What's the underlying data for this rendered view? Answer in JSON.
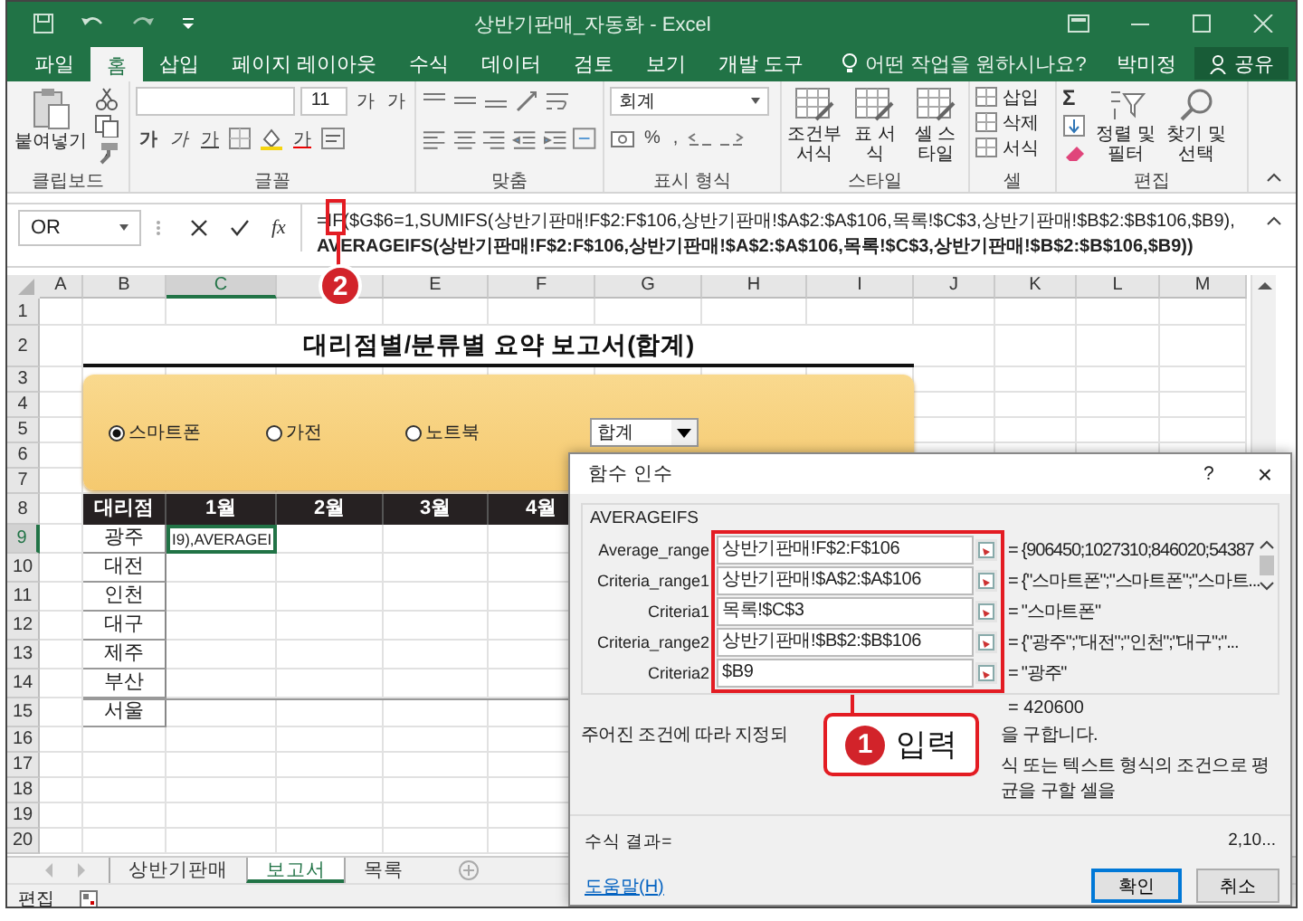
{
  "window": {
    "title": "상반기판매_자동화 - Excel"
  },
  "ribbon_tabs": [
    {
      "label": "파일",
      "selected": false
    },
    {
      "label": "홈",
      "selected": true
    },
    {
      "label": "삽입",
      "selected": false
    },
    {
      "label": "페이지 레이아웃",
      "selected": false
    },
    {
      "label": "수식",
      "selected": false
    },
    {
      "label": "데이터",
      "selected": false
    },
    {
      "label": "검토",
      "selected": false
    },
    {
      "label": "보기",
      "selected": false
    },
    {
      "label": "개발 도구",
      "selected": false
    }
  ],
  "tell_me": {
    "placeholder": "어떤 작업을 원하시나요?"
  },
  "user": "박미정",
  "share_button": "공유",
  "ribbon_groups": [
    {
      "kind": "clipboard",
      "label": "클립보드",
      "buttons": [
        "붙여넣기"
      ]
    },
    {
      "kind": "font",
      "label": "글꼴",
      "size": "11",
      "buttons": [
        "가",
        "가",
        "가",
        "가",
        "가",
        "가"
      ]
    },
    {
      "kind": "alignment",
      "label": "맞춤"
    },
    {
      "kind": "number",
      "label": "표시 형식",
      "format": "회계",
      "buttons": [
        "%",
        ","
      ]
    },
    {
      "kind": "styles",
      "label": "스타일",
      "buttons": [
        "조건부 서식",
        "표 서식",
        "셀 스타일"
      ]
    },
    {
      "kind": "cells",
      "label": "셀",
      "buttons": [
        "삽입",
        "삭제",
        "서식"
      ]
    },
    {
      "kind": "editing",
      "label": "편집",
      "buttons": [
        "Σ",
        "정렬 및 필터",
        "찾기 및 선택"
      ]
    }
  ],
  "formula_bar": {
    "name_box": "OR",
    "fx": "fx",
    "lines": [
      {
        "text": "=IF($G$6=1,SUMIFS(상반기판매!F$2:F$106,상반기판매!$A$2:$A$106,목록!$C$3,상반기판매!$B$2:$B$106,$B9),",
        "bold": false
      },
      {
        "text": "AVERAGEIFS(상반기판매!F$2:F$106,상반기판매!$A$2:$A$106,목록!$C$3,상반기판매!$B$2:$B$106,$B9))",
        "bold": true
      }
    ]
  },
  "columns": [
    {
      "label": "A",
      "selected": false
    },
    {
      "label": "B",
      "selected": false
    },
    {
      "label": "C",
      "selected": true
    },
    {
      "selected": false
    },
    {
      "label": "E",
      "selected": false
    },
    {
      "label": "F",
      "selected": false
    },
    {
      "label": "G",
      "selected": false
    },
    {
      "label": "H",
      "selected": false
    },
    {
      "label": "I",
      "selected": false
    },
    {
      "label": "J",
      "selected": false
    },
    {
      "label": "K",
      "selected": false
    },
    {
      "label": "L",
      "selected": false
    },
    {
      "label": "M",
      "selected": false
    }
  ],
  "rows": [
    {
      "label": "1",
      "selected": false
    },
    {
      "label": "2",
      "selected": false
    },
    {
      "label": "3",
      "selected": false
    },
    {
      "label": "4",
      "selected": false
    },
    {
      "label": "5",
      "selected": false
    },
    {
      "label": "6",
      "selected": false
    },
    {
      "label": "7",
      "selected": false
    },
    {
      "label": "8",
      "selected": false
    },
    {
      "label": "9",
      "selected": true
    },
    {
      "label": "10",
      "selected": false
    },
    {
      "label": "11",
      "selected": false
    },
    {
      "label": "12",
      "selected": false
    },
    {
      "label": "13",
      "selected": false
    },
    {
      "label": "14",
      "selected": false
    },
    {
      "label": "15",
      "selected": false
    },
    {
      "label": "16",
      "selected": false
    },
    {
      "label": "17",
      "selected": false
    },
    {
      "label": "18",
      "selected": false
    },
    {
      "label": "19",
      "selected": false
    },
    {
      "label": "20",
      "selected": false
    }
  ],
  "report": {
    "title": "대리점별/분류별 요약 보고서(합계)",
    "options": [
      {
        "label": "스마트폰",
        "selected": true
      },
      {
        "label": "가전",
        "selected": false
      },
      {
        "label": "노트북",
        "selected": false
      }
    ],
    "dropdown": "합계",
    "header": [
      "대리점",
      "1월",
      "2월",
      "3월",
      "4월"
    ],
    "branches": [
      "광주",
      "대전",
      "인천",
      "대구",
      "제주",
      "부산",
      "서울"
    ],
    "active_cell": "I9),AVERAGEI"
  },
  "dialog": {
    "title": "함수 인수",
    "help": "?",
    "close": "×",
    "function": "AVERAGEIFS",
    "args": [
      {
        "name": "Average_range",
        "value": "상반기판매!F$2:F$106",
        "result": "= {906450;1027310;846020;54387"
      },
      {
        "name": "Criteria_range1",
        "value": "상반기판매!$A$2:$A$106",
        "result": "= {\"스마트폰\";\"스마트폰\";\"스마트..."
      },
      {
        "name": "Criteria1",
        "value": "목록!$C$3",
        "result": "= \"스마트폰\""
      },
      {
        "name": "Criteria_range2",
        "value": "상반기판매!$B$2:$B$106",
        "result": "= {\"광주\";\"대전\";\"인천\";\"대구\";\"..."
      },
      {
        "name": "Criteria2",
        "value": "$B9",
        "result": "= \"광주\""
      }
    ],
    "total": "= 420600",
    "description": [
      "주어진 조건에 따라 지정되",
      "을 구합니다."
    ],
    "arg_help": "식 또는 텍스트 형식의 조건으로 평균을 구할 셀을",
    "result_label": "수식 결과=",
    "result_value": "2,10...",
    "help_link": "도움말(H)",
    "buttons": [
      "확인",
      "취소"
    ]
  },
  "callouts": [
    {
      "number": "1",
      "label": "입력"
    },
    {
      "number": "2"
    }
  ],
  "sheet_tabs": [
    {
      "label": "상반기판매",
      "selected": false
    },
    {
      "label": "보고서",
      "selected": true
    },
    {
      "label": "목록",
      "selected": false
    }
  ],
  "status_bar": {
    "mode": "편집"
  }
}
